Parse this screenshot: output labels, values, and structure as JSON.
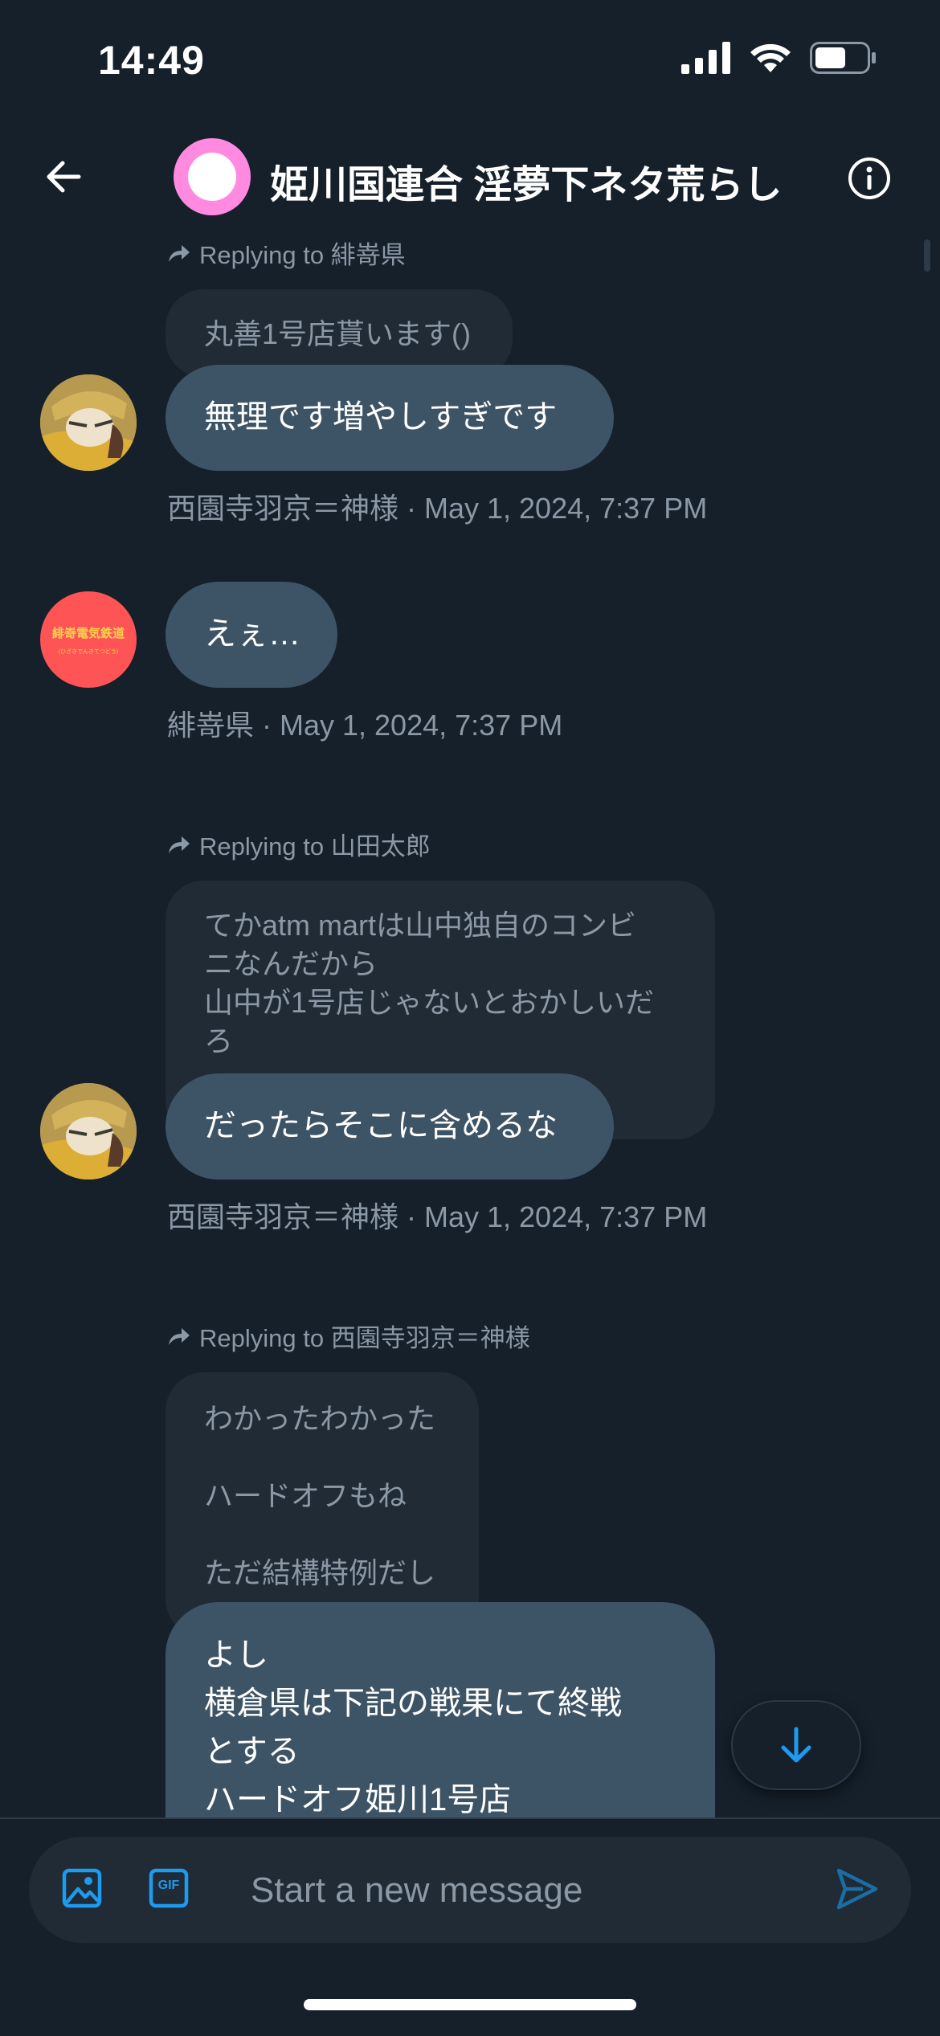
{
  "status_bar": {
    "time": "14:49",
    "battery_level": 0.6
  },
  "header": {
    "title": "姫川国連合 淫夢下ネタ荒らし",
    "avatar_color": "#ff8ae0"
  },
  "messages": [
    {
      "reply_to": "Replying to 緋嵜県",
      "quoted": [
        "丸善1号店貰います()"
      ],
      "text": [
        "無理です増やしすぎです"
      ],
      "meta": "西園寺羽京＝神様 · May 1, 2024, 7:37 PM"
    },
    {
      "avatar_text": [
        "緋嵜電気鉄道",
        "(ひざきでんきてつどう)"
      ],
      "text": [
        "えぇ…"
      ],
      "meta": "緋嵜県 · May 1, 2024, 7:37 PM"
    },
    {
      "reply_to": "Replying to 山田太郎",
      "quoted": [
        "てかatm martは山中独自のコンビ",
        "ニなんだから",
        "山中が1号店じゃないとおかしいだ",
        "ろ"
      ],
      "text": [
        "だったらそこに含めるな"
      ],
      "meta": "西園寺羽京＝神様 · May 1, 2024, 7:37 PM"
    },
    {
      "reply_to": "Replying to 西園寺羽京＝神様",
      "quoted": [
        "わかったわかった",
        "",
        "ハードオフもね",
        "",
        "ただ結構特例だし"
      ],
      "text": [
        "よし",
        "横倉県は下記の戦果にて終戦",
        "とする",
        "ハードオフ姫川1号店"
      ]
    }
  ],
  "composer": {
    "placeholder": "Start a new message",
    "gif_label": "GIF"
  },
  "colors": {
    "background": "#15202b",
    "bubble": "#3d5466",
    "quoted": "#202b36",
    "accent": "#1d9bf0",
    "muted": "#8b98a5"
  },
  "icons": [
    "back-arrow-icon",
    "info-icon",
    "reply-arrow-icon",
    "image-icon",
    "gif-icon",
    "send-icon",
    "arrow-down-icon",
    "signal-icon",
    "wifi-icon",
    "battery-icon"
  ]
}
